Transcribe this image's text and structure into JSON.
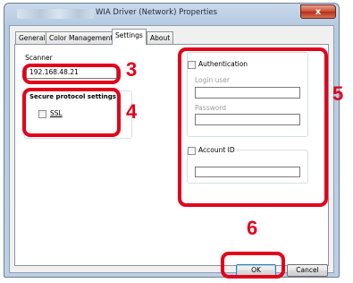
{
  "window": {
    "title": "WIA Driver (Network) Properties",
    "close_glyph": "x"
  },
  "tabs": [
    {
      "label": "General"
    },
    {
      "label": "Color Management"
    },
    {
      "label": "Settings"
    },
    {
      "label": "About"
    }
  ],
  "active_tab": "Settings",
  "scanner": {
    "label": "Scanner",
    "address_value": "192.168.48.21"
  },
  "secure_protocol": {
    "group_label": "Secure protocol settings",
    "ssl_label": "SSL",
    "ssl_checked": false
  },
  "authentication": {
    "checkbox_label": "Authentication",
    "checked": false,
    "login_user_label": "Login user",
    "login_user_value": "",
    "password_label": "Password",
    "password_value": ""
  },
  "account_id": {
    "checkbox_label": "Account ID",
    "checked": false,
    "value": ""
  },
  "buttons": {
    "ok": "OK",
    "cancel": "Cancel"
  },
  "annotations": {
    "scanner_number": "3",
    "secure_number": "4",
    "auth_number": "5",
    "ok_number": "6",
    "color": "#e3001b"
  }
}
